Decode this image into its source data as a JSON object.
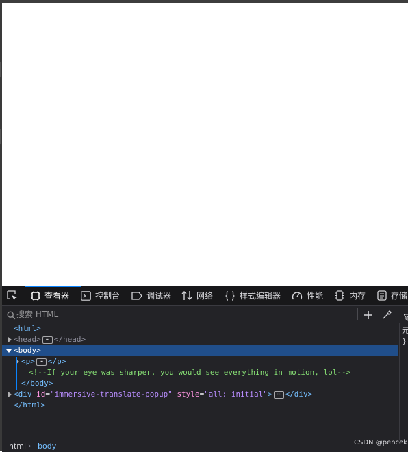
{
  "toolbar": {
    "tabs": [
      {
        "label": "查看器",
        "icon": "inspector-icon"
      },
      {
        "label": "控制台",
        "icon": "console-icon"
      },
      {
        "label": "调试器",
        "icon": "debugger-icon"
      },
      {
        "label": "网络",
        "icon": "network-icon"
      },
      {
        "label": "样式编辑器",
        "icon": "style-editor-icon"
      },
      {
        "label": "性能",
        "icon": "performance-icon"
      },
      {
        "label": "内存",
        "icon": "memory-icon"
      },
      {
        "label": "存储",
        "icon": "storage-icon"
      }
    ],
    "active_tab": "查看器"
  },
  "search": {
    "placeholder": "搜索 HTML"
  },
  "tree": {
    "html_open": "<html>",
    "head_open": "<head>",
    "head_close": "</head>",
    "body_open": "<body>",
    "p_open": "<p>",
    "p_close": "</p>",
    "comment": "<!--If your eye was sharper, you would see everything in motion, lol-->",
    "body_close": "</body>",
    "div_open": "<div",
    "div_attr1_name": "id",
    "div_attr1_value": "\"immersive-translate-popup\"",
    "div_attr2_name": "style",
    "div_attr2_value": "\"all: initial\"",
    "div_gt": ">",
    "div_close": "</div>",
    "html_close": "</html>",
    "ellipsis": "⋯"
  },
  "side_panel": {
    "line1": "元",
    "line2": "}"
  },
  "breadcrumbs": {
    "items": [
      "html",
      "body"
    ]
  },
  "watermark": "CSDN @pencek",
  "colors": {
    "accent": "#0a84ff",
    "selection": "#204e8a",
    "tag": "#75bfff",
    "attr_name": "#ff97e3",
    "attr_value": "#b98eff",
    "comment": "#86de74"
  }
}
